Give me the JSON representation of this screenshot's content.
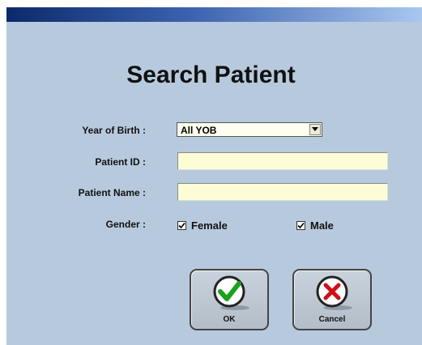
{
  "window": {
    "title": ""
  },
  "form": {
    "heading": "Search Patient",
    "yob": {
      "label": "Year of Birth :",
      "value": "All YOB"
    },
    "patient_id": {
      "label": "Patient ID :",
      "value": "",
      "placeholder": ""
    },
    "patient_name": {
      "label": "Patient Name :",
      "value": "",
      "placeholder": ""
    },
    "gender": {
      "label": "Gender :",
      "options": [
        {
          "label": "Female",
          "checked": true
        },
        {
          "label": "Male",
          "checked": true
        }
      ]
    }
  },
  "buttons": {
    "ok": {
      "label": "OK",
      "icon": "check-icon"
    },
    "cancel": {
      "label": "Cancel",
      "icon": "x-icon"
    }
  },
  "colors": {
    "window_bg": "#b7cadd",
    "input_bg": "#fcfdd6",
    "ok_icon": "#1aa01a",
    "cancel_icon": "#d0101a"
  }
}
